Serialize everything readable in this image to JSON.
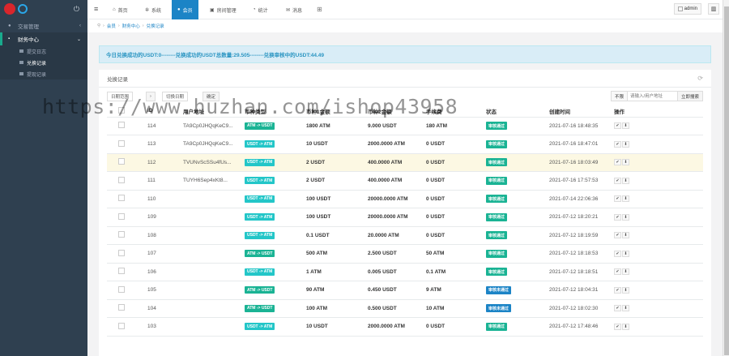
{
  "sidebar": {
    "menu": [
      {
        "label": "交易管理",
        "icon": "user-icon",
        "active": false
      },
      {
        "label": "财务中心",
        "icon": "finance-icon",
        "active": true
      }
    ],
    "submenu": [
      {
        "label": "提交日志",
        "current": false
      },
      {
        "label": "兑换记录",
        "current": true
      },
      {
        "label": "提现记录",
        "current": false
      }
    ]
  },
  "topnav": {
    "tabs": [
      {
        "label": "首页",
        "icon": "home-icon"
      },
      {
        "label": "系统",
        "icon": "gear-icon"
      },
      {
        "label": "会员",
        "icon": "user-icon",
        "active": true
      },
      {
        "label": "房间管理",
        "icon": "room-icon"
      },
      {
        "label": "统计",
        "icon": "chart-icon"
      },
      {
        "label": "消息",
        "icon": "message-icon"
      }
    ],
    "admin": "admin"
  },
  "breadcrumb": [
    "会员",
    "财务中心",
    "兑换记录"
  ],
  "info": "今日兑换成功的USDT:0--------兑换成功的USDT总数量:29.505--------兑换审核中的USDT:44.49",
  "panel": {
    "title": "兑换记录",
    "toolbar": {
      "date_btn": "日期范围",
      "date_btn2": "切换日期",
      "confirm": "确定"
    },
    "search": {
      "select": "不限",
      "placeholder": "请输入/用户地址",
      "button": "立即搜索"
    }
  },
  "table": {
    "headers": [
      "ID",
      "用户地址",
      "币种类型",
      "币种1金额",
      "币种2金额",
      "手续费",
      "状态",
      "创建时间",
      "操作"
    ],
    "rows": [
      {
        "id": "114",
        "addr": "TA9Cp0JHQqKeC9...",
        "type": "ATM -> USDT",
        "amt1": "1800 ATM",
        "amt2": "9.000 USDT",
        "fee": "180 ATM",
        "status": "审核通过",
        "time": "2021-07-16 18:48:35"
      },
      {
        "id": "113",
        "addr": "TA9Cp0JHQqKeC9...",
        "type": "USDT -> ATM",
        "amt1": "10 USDT",
        "amt2": "2000.0000 ATM",
        "fee": "0 USDT",
        "status": "审核通过",
        "time": "2021-07-16 18:47:01"
      },
      {
        "id": "112",
        "addr": "TVUNvScSSu4fUs...",
        "type": "USDT -> ATM",
        "amt1": "2 USDT",
        "amt2": "400.0000 ATM",
        "fee": "0 USDT",
        "status": "审核通过",
        "time": "2021-07-16 18:03:49"
      },
      {
        "id": "111",
        "addr": "TUYH6Sep4xKt8...",
        "type": "USDT -> ATM",
        "amt1": "2 USDT",
        "amt2": "400.0000 ATM",
        "fee": "0 USDT",
        "status": "审核通过",
        "time": "2021-07-16 17:57:53"
      },
      {
        "id": "110",
        "addr": "",
        "type": "USDT -> ATM",
        "amt1": "100 USDT",
        "amt2": "20000.0000 ATM",
        "fee": "0 USDT",
        "status": "审核通过",
        "time": "2021-07-14 22:06:36"
      },
      {
        "id": "109",
        "addr": "",
        "type": "USDT -> ATM",
        "amt1": "100 USDT",
        "amt2": "20000.0000 ATM",
        "fee": "0 USDT",
        "status": "审核通过",
        "time": "2021-07-12 18:20:21"
      },
      {
        "id": "108",
        "addr": "",
        "type": "USDT -> ATM",
        "amt1": "0.1 USDT",
        "amt2": "20.0000 ATM",
        "fee": "0 USDT",
        "status": "审核通过",
        "time": "2021-07-12 18:19:59"
      },
      {
        "id": "107",
        "addr": "",
        "type": "ATM -> USDT",
        "amt1": "500 ATM",
        "amt2": "2.500 USDT",
        "fee": "50 ATM",
        "status": "审核通过",
        "time": "2021-07-12 18:18:53"
      },
      {
        "id": "106",
        "addr": "",
        "type": "USDT -> ATM",
        "amt1": "1 ATM",
        "amt2": "0.005 USDT",
        "fee": "0.1 ATM",
        "status": "审核通过",
        "time": "2021-07-12 18:18:51"
      },
      {
        "id": "105",
        "addr": "",
        "type": "ATM -> USDT",
        "amt1": "90 ATM",
        "amt2": "0.450 USDT",
        "fee": "9 ATM",
        "status": "审核未通过",
        "time": "2021-07-12 18:04:31"
      },
      {
        "id": "104",
        "addr": "",
        "type": "ATM -> USDT",
        "amt1": "100 ATM",
        "amt2": "0.500 USDT",
        "fee": "10 ATM",
        "status": "审核未通过",
        "time": "2021-07-12 18:02:30"
      },
      {
        "id": "103",
        "addr": "",
        "type": "USDT -> ATM",
        "amt1": "10 USDT",
        "amt2": "2000.0000 ATM",
        "fee": "0 USDT",
        "status": "审核通过",
        "time": "2021-07-12 17:48:46"
      }
    ],
    "highlight_row": 2
  },
  "watermark": "https://www.huzhan.com/ishop43958",
  "colors": {
    "sidebar": "#2f4050",
    "accent": "#1c84c6",
    "badge_teal": "#23c6c8",
    "badge_blue": "#1c84c6",
    "badge_green": "#1ab394"
  }
}
